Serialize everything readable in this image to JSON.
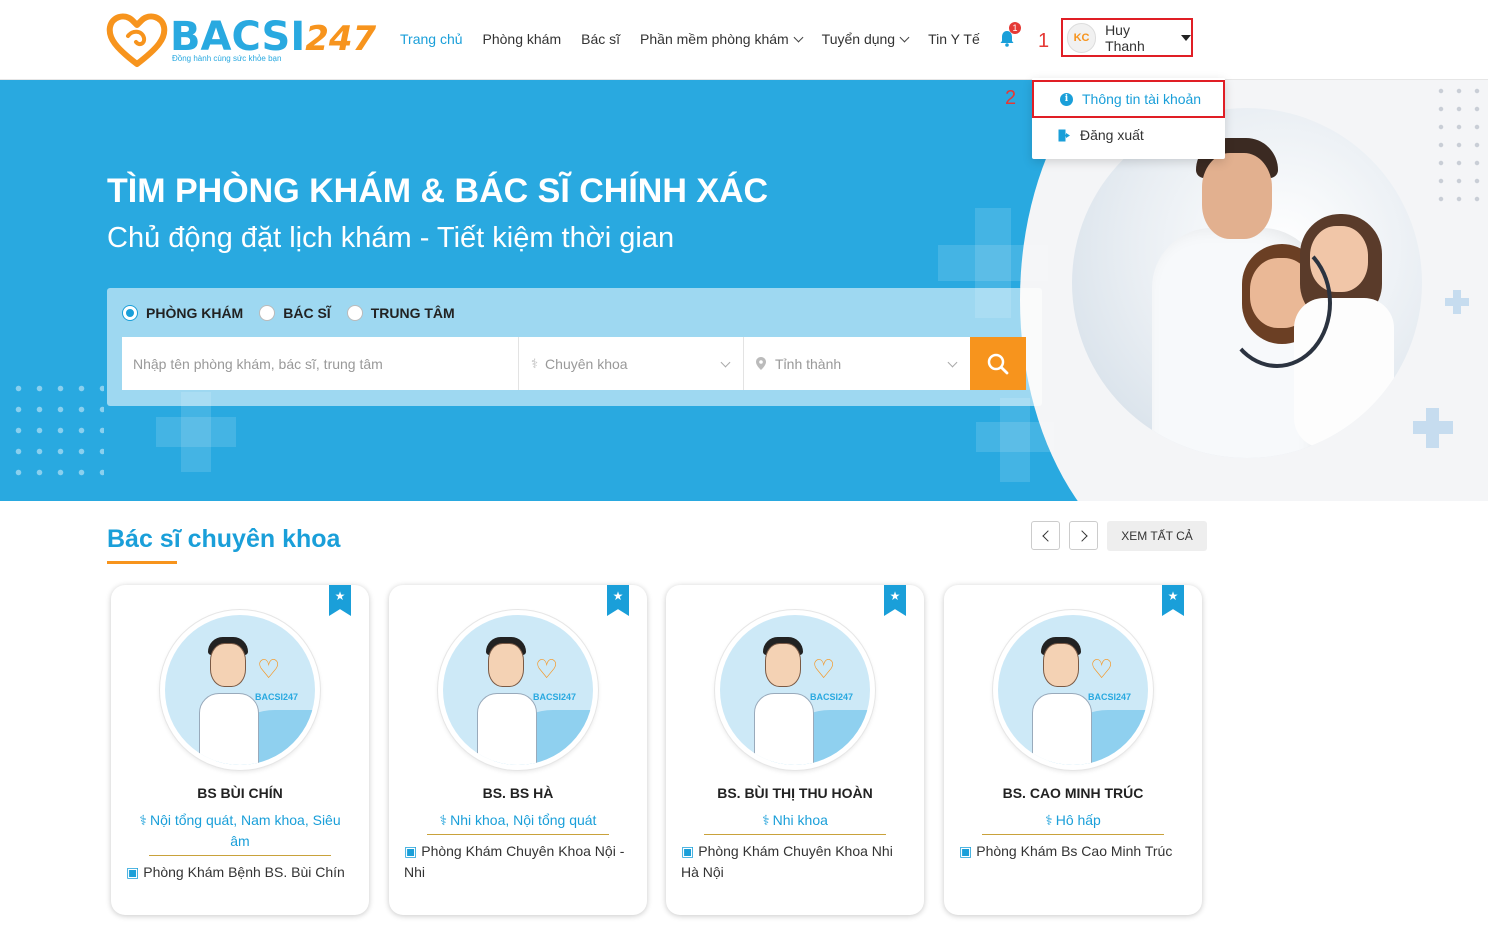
{
  "header": {
    "logo_text": "BACSI",
    "logo_num": "247",
    "logo_tagline": "Đồng hành cùng sức khỏe bạn",
    "nav": [
      {
        "label": "Trang chủ",
        "active": true,
        "dropdown": false
      },
      {
        "label": "Phòng khám",
        "active": false,
        "dropdown": false
      },
      {
        "label": "Bác sĩ",
        "active": false,
        "dropdown": false
      },
      {
        "label": "Phần mềm phòng khám",
        "active": false,
        "dropdown": true
      },
      {
        "label": "Tuyển dụng",
        "active": false,
        "dropdown": true
      },
      {
        "label": "Tin Y Tế",
        "active": false,
        "dropdown": false
      }
    ],
    "notification_count": "1",
    "annotation_1": "1",
    "user": {
      "avatar_text": "KC",
      "name": "Huy Thanh"
    }
  },
  "user_menu": {
    "annotation_2": "2",
    "items": [
      {
        "label": "Thông tin tài khoản",
        "icon": "info-icon"
      },
      {
        "label": "Đăng xuất",
        "icon": "logout-icon"
      }
    ]
  },
  "hero": {
    "title": "TÌM PHÒNG KHÁM & BÁC SĨ CHÍNH XÁC",
    "subtitle": "Chủ động đặt lịch khám - Tiết kiệm thời gian",
    "search": {
      "types": [
        {
          "label": "PHÒNG KHÁM",
          "selected": true
        },
        {
          "label": "BÁC SĨ",
          "selected": false
        },
        {
          "label": "TRUNG TÂM",
          "selected": false
        }
      ],
      "input_placeholder": "Nhập tên phòng khám, bác sĩ, trung tâm",
      "specialty_placeholder": "Chuyên khoa",
      "province_placeholder": "Tỉnh thành"
    }
  },
  "section": {
    "title": "Bác sĩ chuyên khoa",
    "see_all": "XEM TẤT CẢ",
    "doctors": [
      {
        "name": "BS BÙI CHÍN",
        "specialty": "Nội tổng quát, Nam khoa, Siêu âm",
        "clinic": "Phòng Khám Bệnh BS. Bùi Chín"
      },
      {
        "name": "BS. BS HÀ",
        "specialty": "Nhi khoa, Nội tổng quát",
        "clinic": "Phòng Khám Chuyên Khoa Nội - Nhi"
      },
      {
        "name": "BS. BÙI THỊ THU HOÀN",
        "specialty": "Nhi khoa",
        "clinic": "Phòng Khám Chuyên Khoa Nhi Hà Nội"
      },
      {
        "name": "BS. CAO MINH TRÚC",
        "specialty": "Hô hấp",
        "clinic": "Phòng Khám Bs Cao Minh Trúc"
      }
    ]
  },
  "colors": {
    "primary": "#1a9fd9",
    "accent": "#f7941d",
    "hero_bg": "#29a9e0",
    "annotation": "#e01e25"
  }
}
